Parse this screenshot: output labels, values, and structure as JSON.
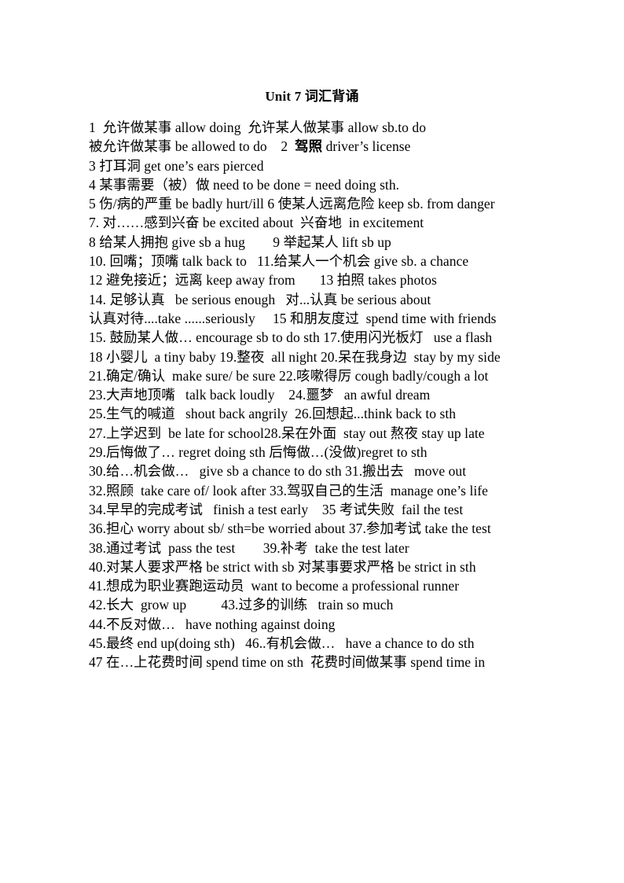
{
  "document": {
    "title": "Unit 7  词汇背诵",
    "lines": [
      "1  允许做某事 allow doing  允许某人做某事 allow sb.to do",
      "被允许做某事 be allowed to do    2  驾照 driver’s license",
      "3 打耳洞 get one’s ears pierced",
      "4 某事需要（被）做 need to be done = need doing sth.",
      "5 伤/病的严重 be badly hurt/ill 6 使某人远离危险 keep sb. from danger",
      "7. 对……感到兴奋 be excited about  兴奋地  in excitement",
      "8 给某人拥抱 give sb a hug        9 举起某人 lift sb up",
      "10. 回嘴；顶嘴 talk back to   11.给某人一个机会 give sb. a chance",
      "12 避免接近；远离 keep away from       13 拍照 takes photos",
      "14. 足够认真   be serious enough   对...认真 be serious about",
      "认真对待....take ......seriously     15 和朋友度过  spend time with friends",
      "15. 鼓励某人做… encourage sb to do sth 17.使用闪光板灯   use a flash",
      "18 小婴儿  a tiny baby 19.整夜  all night 20.呆在我身边  stay by my side",
      "21.确定/确认  make sure/ be sure 22.咳嗽得厉 cough badly/cough a lot",
      "23.大声地顶嘴   talk back loudly    24.噩梦   an awful dream",
      "25.生气的喊道   shout back angrily  26.回想起...think back to sth",
      "27.上学迟到  be late for school28.呆在外面  stay out 熬夜 stay up late",
      "29.后悔做了… regret doing sth 后悔做…(没做)regret to sth",
      "30.给…机会做…   give sb a chance to do sth 31.搬出去   move out",
      "32.照顾  take care of/ look after 33.驾驭自己的生活  manage one’s life",
      "34.早早的完成考试   finish a test early    35 考试失败  fail the test",
      "36.担心 worry about sb/ sth=be worried about 37.参加考试 take the test",
      "38.通过考试  pass the test        39.补考  take the test later",
      "40.对某人要求严格 be strict with sb 对某事要求严格 be strict in sth",
      "41.想成为职业赛跑运动员  want to become a professional runner",
      "42.长大  grow up          43.过多的训练   train so much",
      "44.不反对做…   have nothing against doing",
      "45.最终 end up(doing sth)   46..有机会做…   have a chance to do sth",
      "47 在…上花费时间 spend time on sth  花费时间做某事 spend time in"
    ],
    "bold_segments": {
      "line_index": 1,
      "text": "驾照"
    }
  }
}
